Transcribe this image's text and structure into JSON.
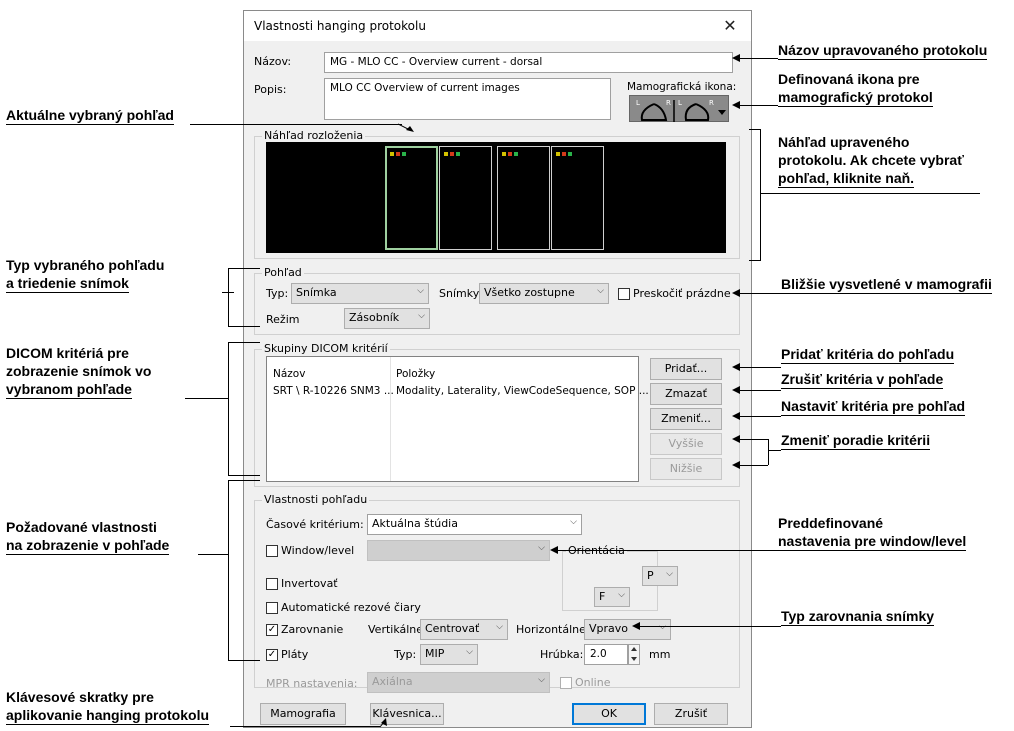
{
  "dialog": {
    "title": "Vlastnosti hanging protokolu",
    "close_glyph": "✕",
    "name_label": "Názov:",
    "name_value": "MG - MLO CC - Overview current - dorsal",
    "desc_label": "Popis:",
    "desc_value": "MLO CC Overview of current images",
    "mammo_icon_label": "Mamografická ikona:",
    "mammo_icon": {
      "left_tag": "L",
      "mid_tag": "R",
      "mid_tag2": "L",
      "right_tag": "R"
    },
    "layout_preview_label": "Náhľad rozloženia",
    "view": {
      "group_label": "Pohľad",
      "type_label": "Typ:",
      "type_value": "Snímka",
      "images_label": "Snímky:",
      "images_value": "Všetko zostupne",
      "skip_empty_label": "Preskočiť prázdne",
      "skip_empty_checked": false,
      "mode_label": "Režim",
      "mode_value": "Zásobník"
    },
    "dicom": {
      "group_label": "Skupiny DICOM kritérií",
      "columns": [
        "Názov",
        "Položky"
      ],
      "rows": [
        [
          "SRT \\ R-10226 SNM3 ...",
          "Modality, Laterality, ViewCodeSequence, SOP ..."
        ]
      ],
      "buttons": {
        "add": "Pridať...",
        "delete": "Zmazať",
        "change": "Zmeniť...",
        "up": "Vyššie",
        "down": "Nižšie"
      }
    },
    "props": {
      "group_label": "Vlastnosti pohľadu",
      "time_label": "Časové kritérium:",
      "time_value": "Aktuálna štúdia",
      "window_level_label": "Window/level",
      "window_level_checked": false,
      "window_level_value": "",
      "orientation_label": "Orientácia",
      "orientation_h": "P",
      "orientation_v": "F",
      "invert_label": "Invertovať",
      "invert_checked": false,
      "auto_lines_label": "Automatické rezové čiary",
      "auto_lines_checked": false,
      "align_label": "Zarovnanie",
      "align_checked": true,
      "vertical_label": "Vertikálne:",
      "vertical_value": "Centrovať",
      "horizontal_label": "Horizontálne:",
      "horizontal_value": "Vpravo",
      "slabs_label": "Pláty",
      "slabs_checked": true,
      "slab_type_label": "Typ:",
      "slab_type_value": "MIP",
      "thickness_label": "Hrúbka:",
      "thickness_value": "2.0",
      "thickness_unit": "mm",
      "mpr_label": "MPR nastavenia:",
      "mpr_value": "Axiálna",
      "online_label": "Online"
    },
    "footer": {
      "mammo": "Mamografia",
      "keyboard": "Klávesnica...",
      "ok": "OK",
      "cancel": "Zrušiť"
    },
    "check_glyph": "✓",
    "chevron_glyph": "⌵"
  },
  "annotations": {
    "name_edit": "Názov upravovaného protokolu",
    "icon_def_1": "Definovaná ikona pre",
    "icon_def_2": "mamografický protokol",
    "current_view": "Aktuálne vybraný pohľad",
    "preview_1": "Náhľad upraveného",
    "preview_2": "protokolu. Ak chcete vybrať",
    "preview_3": "pohľad, kliknite naň.",
    "view_type_1": "Typ vybraného pohľadu",
    "view_type_2": "a triedenie snímok",
    "mammo_more": "Bližšie vysvetlené v mamografii",
    "dicom_1": "DICOM kritériá pre",
    "dicom_2": "zobrazenie snímok vo",
    "dicom_3": "vybranom pohľade",
    "add_crit": "Pridať kritéria do pohľadu",
    "del_crit": "Zrušiť kritéria v pohľade",
    "set_crit": "Nastaviť kritéria pre pohľad",
    "order_crit": "Zmeniť poradie kritérii",
    "req_props_1": "Požadované vlastnosti",
    "req_props_2": "na zobrazenie v pohľade",
    "wl_1": "Preddefinované",
    "wl_2": "nastavenia pre window/level",
    "align_type": "Typ zarovnania snímky",
    "shortcuts_1": "Klávesové skratky pre",
    "shortcuts_2": "aplikovanie hanging protokolu"
  }
}
